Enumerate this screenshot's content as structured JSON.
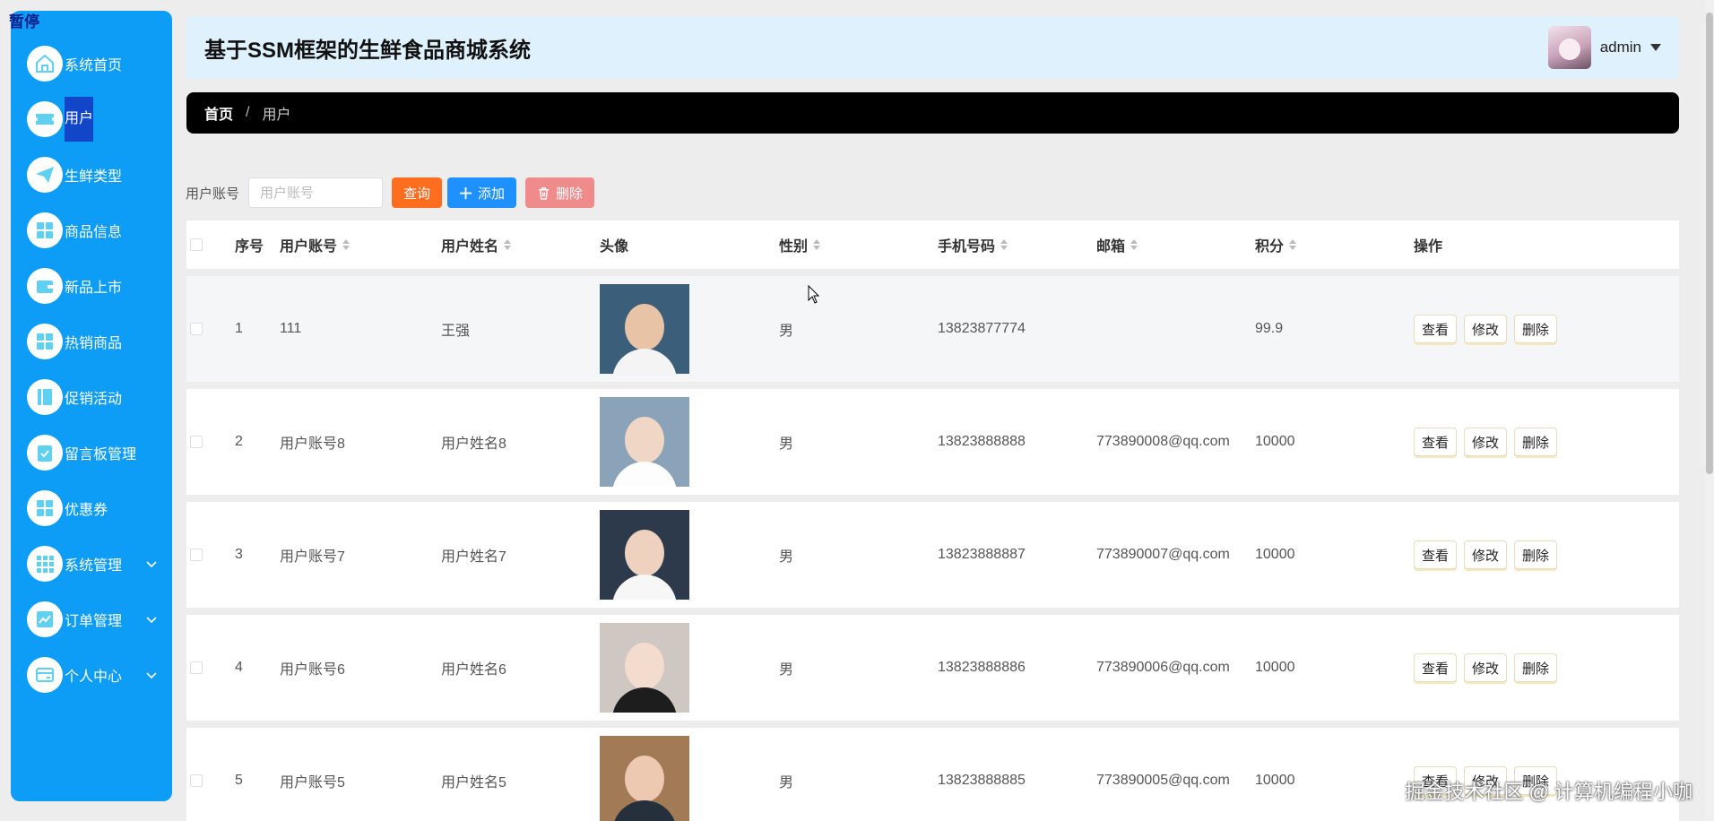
{
  "overlay": {
    "pause_label": "暂停"
  },
  "sidebar": {
    "items": [
      {
        "label": "系统首页",
        "icon": "home-icon",
        "active": false,
        "expandable": false
      },
      {
        "label": "用户",
        "icon": "ticket-icon",
        "active": true,
        "expandable": false
      },
      {
        "label": "生鲜类型",
        "icon": "paper-plane-icon",
        "active": false,
        "expandable": false
      },
      {
        "label": "商品信息",
        "icon": "grid-icon",
        "active": false,
        "expandable": false
      },
      {
        "label": "新品上市",
        "icon": "wallet-icon",
        "active": false,
        "expandable": false
      },
      {
        "label": "热销商品",
        "icon": "grid-icon",
        "active": false,
        "expandable": false
      },
      {
        "label": "促销活动",
        "icon": "book-icon",
        "active": false,
        "expandable": false
      },
      {
        "label": "留言板管理",
        "icon": "clipboard-icon",
        "active": false,
        "expandable": false
      },
      {
        "label": "优惠券",
        "icon": "grid-icon",
        "active": false,
        "expandable": false
      },
      {
        "label": "系统管理",
        "icon": "apps-icon",
        "active": false,
        "expandable": true
      },
      {
        "label": "订单管理",
        "icon": "chart-icon",
        "active": false,
        "expandable": true
      },
      {
        "label": "个人中心",
        "icon": "card-icon",
        "active": false,
        "expandable": true
      }
    ]
  },
  "header": {
    "title": "基于SSM框架的生鲜食品商城系统",
    "user": "admin"
  },
  "breadcrumb": {
    "home": "首页",
    "separator": "/",
    "current": "用户"
  },
  "search": {
    "label": "用户账号",
    "placeholder": "用户账号",
    "query_label": "查询",
    "add_label": "添加",
    "delete_label": "删除"
  },
  "table": {
    "columns": [
      "序号",
      "用户账号",
      "用户姓名",
      "头像",
      "性别",
      "手机号码",
      "邮箱",
      "积分",
      "操作"
    ],
    "actions": {
      "view": "查看",
      "edit": "修改",
      "delete": "删除"
    },
    "rows": [
      {
        "index": "1",
        "account": "111",
        "name": "王强",
        "gender": "男",
        "phone": "13823877774",
        "email": "",
        "score": "99.9"
      },
      {
        "index": "2",
        "account": "用户账号8",
        "name": "用户姓名8",
        "gender": "男",
        "phone": "13823888888",
        "email": "773890008@qq.com",
        "score": "10000"
      },
      {
        "index": "3",
        "account": "用户账号7",
        "name": "用户姓名7",
        "gender": "男",
        "phone": "13823888887",
        "email": "773890007@qq.com",
        "score": "10000"
      },
      {
        "index": "4",
        "account": "用户账号6",
        "name": "用户姓名6",
        "gender": "男",
        "phone": "13823888886",
        "email": "773890006@qq.com",
        "score": "10000"
      },
      {
        "index": "5",
        "account": "用户账号5",
        "name": "用户姓名5",
        "gender": "男",
        "phone": "13823888885",
        "email": "773890005@qq.com",
        "score": "10000"
      }
    ]
  },
  "watermark": "掘金技术社区 @ 计算机编程小咖",
  "colors": {
    "sidebar": "#0d9cf6",
    "active_item": "#1146c9",
    "query_button": "#ff6d1f",
    "add_button": "#1e90ff",
    "delete_button": "#f08b8b",
    "icon_color": "#5fd0f0"
  }
}
